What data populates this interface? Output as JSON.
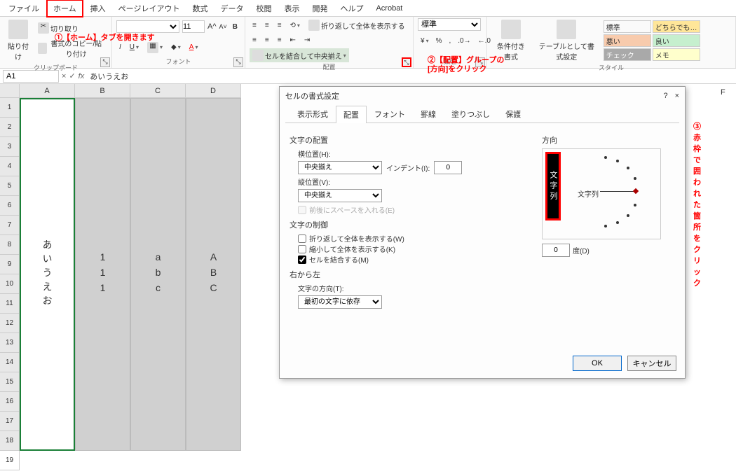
{
  "tabs": {
    "file": "ファイル",
    "home": "ホーム",
    "insert": "挿入",
    "layout": "ページレイアウト",
    "formulas": "数式",
    "data": "データ",
    "review": "校閲",
    "view": "表示",
    "developer": "開発",
    "help": "ヘルプ",
    "acrobat": "Acrobat"
  },
  "ribbon": {
    "clipboard": {
      "label": "クリップボード",
      "paste": "貼り付け",
      "cut": "切り取り",
      "copy": "書式のコピー/貼り付け"
    },
    "font": {
      "label": "フォント",
      "size": "11"
    },
    "alignment": {
      "label": "配置",
      "wrap": "折り返して全体を表示する",
      "merge": "セルを結合して中央揃え"
    },
    "number": {
      "label": "数値",
      "format": "標準"
    },
    "styles": {
      "label": "スタイル",
      "condfmt": "条件付き書式",
      "tablefmt": "テーブルとして書式設定",
      "gallery": [
        "標準",
        "どちらでも…",
        "悪い",
        "良い",
        "チェック セ…",
        "メモ"
      ]
    }
  },
  "annotations": {
    "a1": "①【ホーム】タブを開きます",
    "a2_l1": "②【配置】グループの",
    "a2_l2": "[方向]をクリック",
    "a3": "③赤枠で囲われた箇所をクリック"
  },
  "namebox": "A1",
  "formula": "あいうえお",
  "columns": [
    "A",
    "B",
    "C",
    "D"
  ],
  "colF": "F",
  "rows": [
    "1",
    "2",
    "3",
    "4",
    "5",
    "6",
    "7",
    "8",
    "9",
    "10",
    "11",
    "12",
    "13",
    "14",
    "15",
    "16",
    "17",
    "18",
    "19"
  ],
  "cells": {
    "A": "あいうえお",
    "B": "111",
    "C": "abc",
    "D": "ABC"
  },
  "dialog": {
    "title": "セルの書式設定",
    "help": "?",
    "close": "×",
    "tabs": {
      "number": "表示形式",
      "alignment": "配置",
      "font": "フォント",
      "border": "罫線",
      "fill": "塗りつぶし",
      "protection": "保護"
    },
    "sect_align": "文字の配置",
    "horiz_label": "横位置(H):",
    "horiz_value": "中央揃え",
    "indent_label": "インデント(I):",
    "indent_value": "0",
    "vert_label": "縦位置(V):",
    "vert_value": "中央揃え",
    "justify": "前後にスペースを入れる(E)",
    "sect_ctrl": "文字の制御",
    "wrap": "折り返して全体を表示する(W)",
    "shrink": "縮小して全体を表示する(K)",
    "merge": "セルを結合する(M)",
    "sect_rtl": "右から左",
    "textdir_label": "文字の方向(T):",
    "textdir_value": "最初の文字に依存",
    "orient_title": "方向",
    "orient_vtext": "文字列",
    "orient_htext": "文字列",
    "deg_value": "0",
    "deg_label": "度(D)",
    "ok": "OK",
    "cancel": "キャンセル"
  }
}
